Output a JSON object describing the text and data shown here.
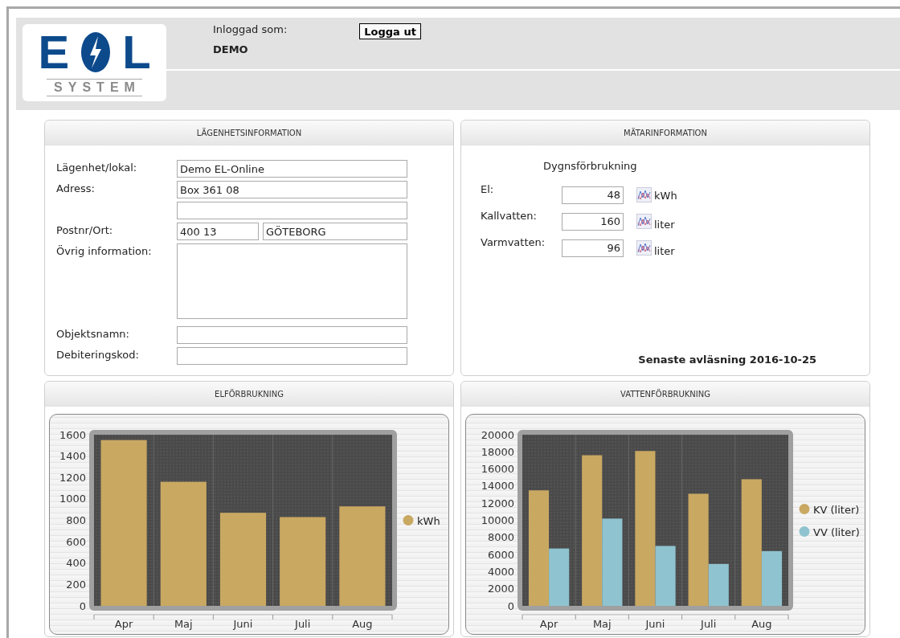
{
  "header": {
    "logo": {
      "left": "E",
      "right": "L",
      "sub": "SYSTEM"
    },
    "login_label": "Inloggad som:",
    "user": "DEMO",
    "logout_button": "Logga ut"
  },
  "apartment_panel": {
    "title": "LÄGENHETSINFORMATION",
    "fields": [
      {
        "label": "Lägenhet/lokal:",
        "kind": "single",
        "values": [
          "Demo EL-Online"
        ]
      },
      {
        "label": "Adress:",
        "kind": "single",
        "values": [
          "Box 361 08"
        ]
      },
      {
        "kind": "single"
      },
      {
        "label": "Postnr/Ort:",
        "kind": "pair",
        "values": [
          "400 13",
          "GÖTEBORG"
        ]
      },
      {
        "label": "Övrig information:",
        "kind": "multiline"
      },
      {
        "label": "Objektsnamn:",
        "kind": "single"
      },
      {
        "label": "Debiteringskod:",
        "kind": "single"
      }
    ]
  },
  "meter_panel": {
    "title": "MÄTARINFORMATION",
    "heading": "Dygnsförbrukning",
    "rows": [
      {
        "label": "El:",
        "value": "48",
        "unit": "kWh"
      },
      {
        "label": "Kallvatten:",
        "value": "160",
        "unit": "liter"
      },
      {
        "label": "Varmvatten:",
        "value": "96",
        "unit": "liter"
      }
    ],
    "last_reading": "Senaste avläsning 2016-10-25"
  },
  "electricity_panel": {
    "title": "ELFÖRBRUKNING",
    "chart_data": {
      "type": "bar",
      "categories": [
        "Apr",
        "Maj",
        "Juni",
        "Juli",
        "Aug"
      ],
      "legend": "right",
      "series": [
        {
          "name": "kWh",
          "color": "#c9a862",
          "values": [
            1550,
            1160,
            870,
            830,
            930
          ]
        }
      ],
      "ylim": [
        0,
        1600
      ],
      "yticks": [
        0,
        200,
        400,
        600,
        800,
        1000,
        1200,
        1400,
        1600
      ]
    }
  },
  "water_panel": {
    "title": "VATTENFÖRBRUKNING",
    "chart_data": {
      "type": "bar",
      "stacked": false,
      "legend": "right",
      "categories": [
        "Apr",
        "Maj",
        "Juni",
        "Juli",
        "Aug"
      ],
      "series": [
        {
          "name": "KV (liter)",
          "color": "#c9a862",
          "values": [
            13500,
            17600,
            18100,
            13100,
            14800
          ]
        },
        {
          "name": "VV (liter)",
          "color": "#8fc3cf",
          "values": [
            6700,
            10200,
            7000,
            4900,
            6400
          ]
        }
      ],
      "ylim": [
        0,
        20000
      ],
      "yticks": [
        0,
        2000,
        4000,
        6000,
        8000,
        10000,
        12000,
        14000,
        16000,
        18000,
        20000
      ]
    }
  }
}
